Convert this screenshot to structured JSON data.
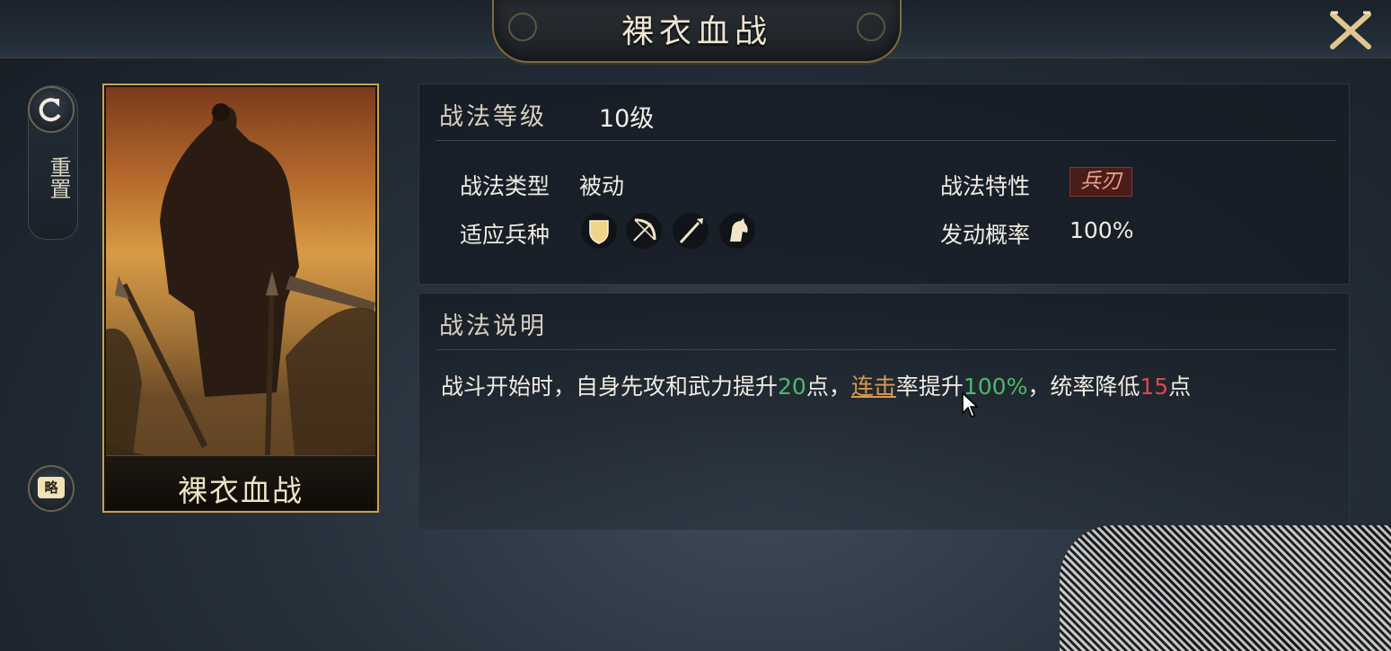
{
  "header": {
    "title": "裸衣血战"
  },
  "side": {
    "reset_label": "重置",
    "brief_label": "略"
  },
  "card": {
    "name": "裸衣血战"
  },
  "skill": {
    "level_label": "战法等级",
    "level_value": "10级",
    "type_label": "战法类型",
    "type_value": "被动",
    "trait_label": "战法特性",
    "trait_value": "兵刃",
    "units_label": "适应兵种",
    "units": [
      "shield-icon",
      "bow-icon",
      "spear-icon",
      "horse-icon"
    ],
    "rate_label": "发动概率",
    "rate_value": "100%"
  },
  "description": {
    "header": "战法说明",
    "part1": "战斗开始时，自身先攻和武力提升",
    "num1": "20",
    "part2": "点，",
    "link": "连击",
    "part3": "率提升",
    "num2": "100%",
    "part4": "，统率降低",
    "num3": "15",
    "part5": "点"
  },
  "colors": {
    "accent_gold": "#c9a24e",
    "positive": "#4db86a",
    "negative": "#d94a4a",
    "link": "#d79b54"
  }
}
